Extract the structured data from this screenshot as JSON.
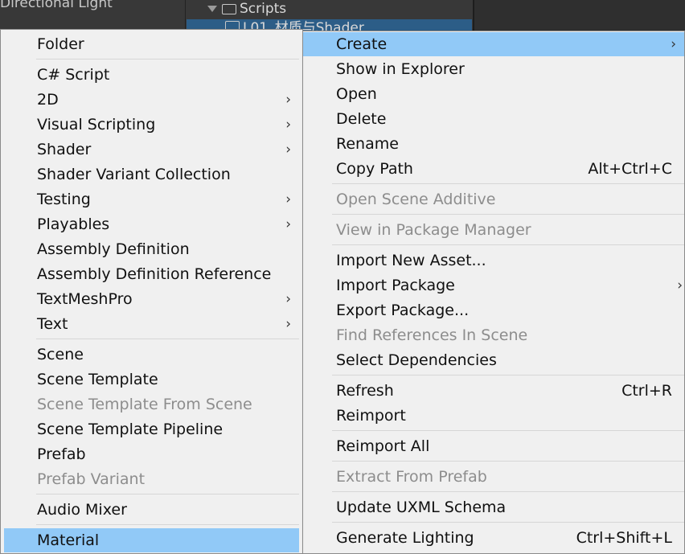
{
  "hierarchy": {
    "row_label": "Directional Light"
  },
  "project": {
    "row1": "Scripts",
    "row2": "L01_材质与Shader"
  },
  "create_submenu": {
    "items": [
      {
        "label": "Folder",
        "submenu": false,
        "disabled": false
      },
      {
        "label": "C# Script",
        "submenu": false,
        "disabled": false
      },
      {
        "label": "2D",
        "submenu": true,
        "disabled": false
      },
      {
        "label": "Visual Scripting",
        "submenu": true,
        "disabled": false
      },
      {
        "label": "Shader",
        "submenu": true,
        "disabled": false
      },
      {
        "label": "Shader Variant Collection",
        "submenu": false,
        "disabled": false
      },
      {
        "label": "Testing",
        "submenu": true,
        "disabled": false
      },
      {
        "label": "Playables",
        "submenu": true,
        "disabled": false
      },
      {
        "label": "Assembly Definition",
        "submenu": false,
        "disabled": false
      },
      {
        "label": "Assembly Definition Reference",
        "submenu": false,
        "disabled": false
      },
      {
        "label": "TextMeshPro",
        "submenu": true,
        "disabled": false
      },
      {
        "label": "Text",
        "submenu": true,
        "disabled": false
      },
      {
        "label": "Scene",
        "submenu": false,
        "disabled": false
      },
      {
        "label": "Scene Template",
        "submenu": false,
        "disabled": false
      },
      {
        "label": "Scene Template From Scene",
        "submenu": false,
        "disabled": true
      },
      {
        "label": "Scene Template Pipeline",
        "submenu": false,
        "disabled": false
      },
      {
        "label": "Prefab",
        "submenu": false,
        "disabled": false
      },
      {
        "label": "Prefab Variant",
        "submenu": false,
        "disabled": true
      },
      {
        "label": "Audio Mixer",
        "submenu": false,
        "disabled": false
      },
      {
        "label": "Material",
        "submenu": false,
        "disabled": false,
        "highlighted": true
      }
    ],
    "arrow_glyph": "›"
  },
  "context_menu": {
    "items": [
      {
        "label": "Create",
        "shortcut": "",
        "submenu": true,
        "disabled": false,
        "highlighted": true
      },
      {
        "label": "Show in Explorer",
        "shortcut": "",
        "submenu": false,
        "disabled": false
      },
      {
        "label": "Open",
        "shortcut": "",
        "submenu": false,
        "disabled": false
      },
      {
        "label": "Delete",
        "shortcut": "",
        "submenu": false,
        "disabled": false
      },
      {
        "label": "Rename",
        "shortcut": "",
        "submenu": false,
        "disabled": false
      },
      {
        "label": "Copy Path",
        "shortcut": "Alt+Ctrl+C",
        "submenu": false,
        "disabled": false
      },
      {
        "label": "Open Scene Additive",
        "shortcut": "",
        "submenu": false,
        "disabled": true
      },
      {
        "label": "View in Package Manager",
        "shortcut": "",
        "submenu": false,
        "disabled": true
      },
      {
        "label": "Import New Asset...",
        "shortcut": "",
        "submenu": false,
        "disabled": false
      },
      {
        "label": "Import Package",
        "shortcut": "",
        "submenu": true,
        "disabled": false
      },
      {
        "label": "Export Package...",
        "shortcut": "",
        "submenu": false,
        "disabled": false
      },
      {
        "label": "Find References In Scene",
        "shortcut": "",
        "submenu": false,
        "disabled": true
      },
      {
        "label": "Select Dependencies",
        "shortcut": "",
        "submenu": false,
        "disabled": false
      },
      {
        "label": "Refresh",
        "shortcut": "Ctrl+R",
        "submenu": false,
        "disabled": false
      },
      {
        "label": "Reimport",
        "shortcut": "",
        "submenu": false,
        "disabled": false
      },
      {
        "label": "Reimport All",
        "shortcut": "",
        "submenu": false,
        "disabled": false
      },
      {
        "label": "Extract From Prefab",
        "shortcut": "",
        "submenu": false,
        "disabled": true
      },
      {
        "label": "Update UXML Schema",
        "shortcut": "",
        "submenu": false,
        "disabled": false
      },
      {
        "label": "Generate Lighting",
        "shortcut": "Ctrl+Shift+L",
        "submenu": false,
        "disabled": false
      }
    ]
  },
  "colors": {
    "highlight": "#91c9f7",
    "menu_bg": "#f0f0f0",
    "disabled_text": "#8d8d8d",
    "editor_bg": "#383838"
  }
}
